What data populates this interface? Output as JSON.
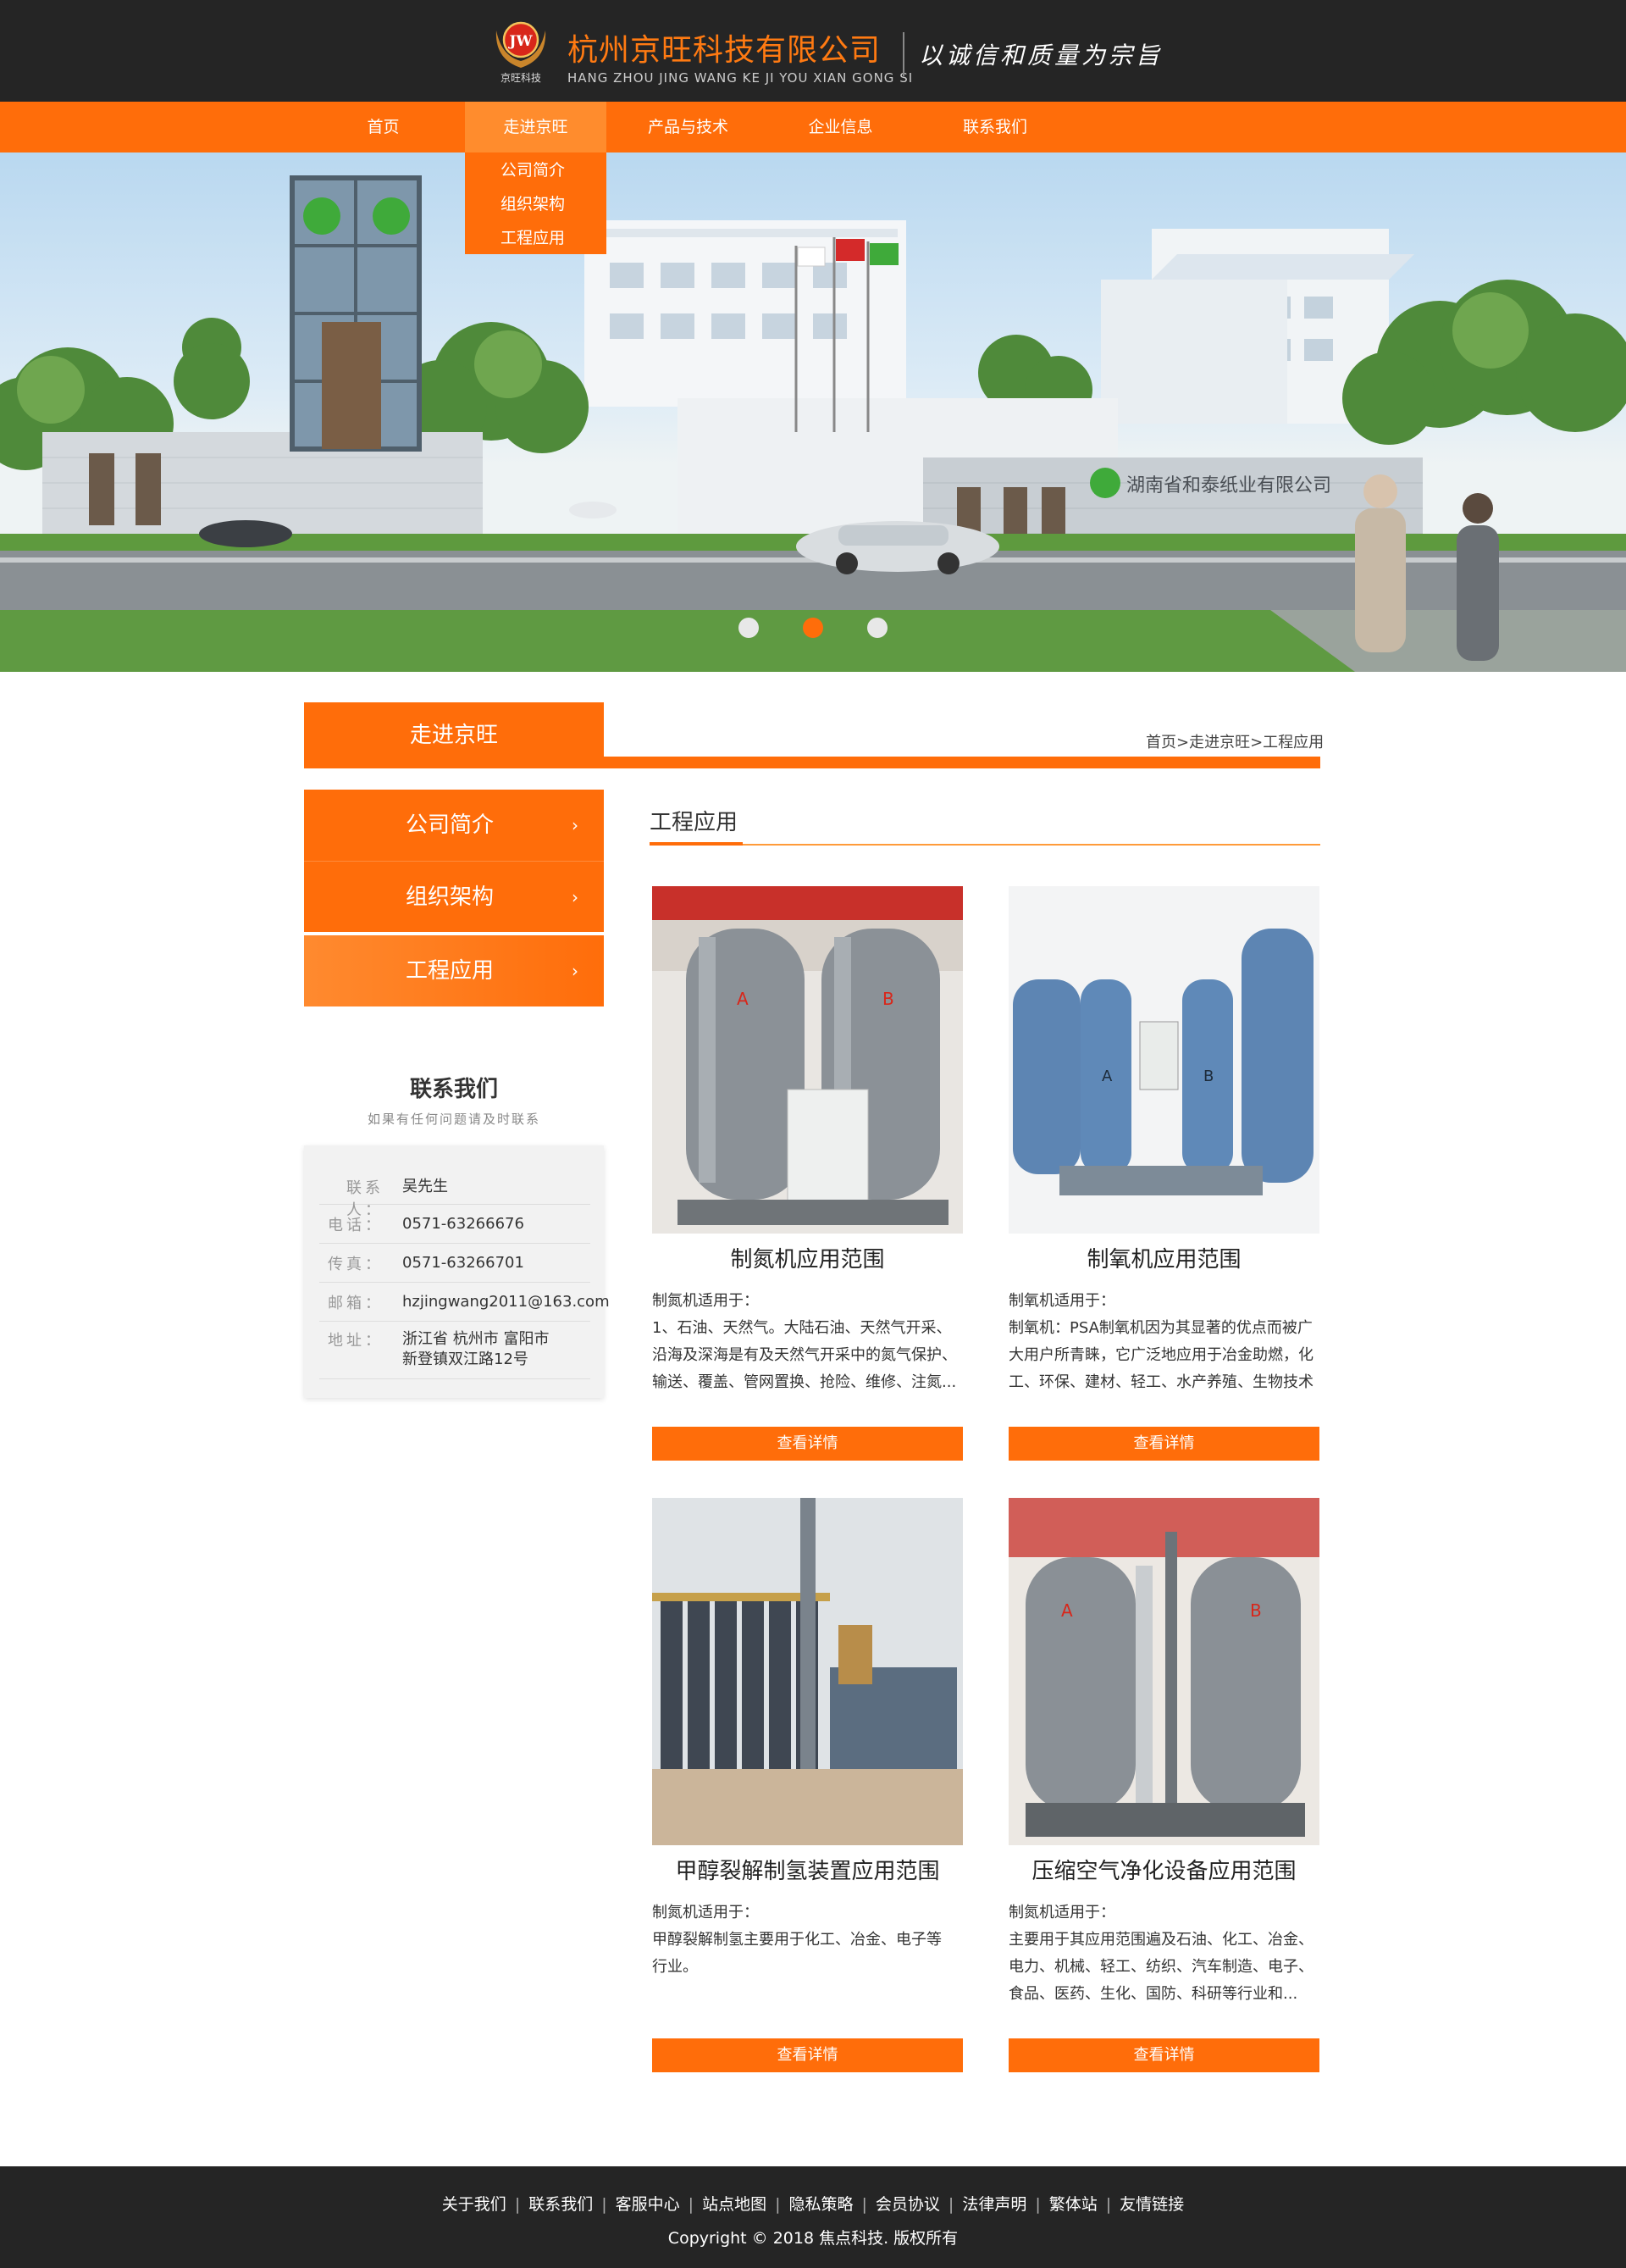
{
  "header": {
    "logo_text": "JW",
    "logo_caption": "京旺科技",
    "company_name": "杭州京旺科技有限公司",
    "company_pinyin": "HANG ZHOU JING WANG KE JI YOU XIAN GONG SI",
    "slogan": "以诚信和质量为宗旨"
  },
  "nav": {
    "items": [
      {
        "label": "首页"
      },
      {
        "label": "走进京旺"
      },
      {
        "label": "产品与技术"
      },
      {
        "label": "企业信息"
      },
      {
        "label": "联系我们"
      }
    ],
    "active_index": 1,
    "dropdown": [
      {
        "label": "公司简介"
      },
      {
        "label": "组织架构"
      },
      {
        "label": "工程应用"
      }
    ]
  },
  "banner": {
    "sign_text": "湖南省和泰纸业有限公司",
    "slides": 3,
    "active_slide": 1
  },
  "section": {
    "tab_label": "走进京旺",
    "breadcrumb": "首页>走进京旺>工程应用",
    "title": "工程应用"
  },
  "sidebar": {
    "items": [
      {
        "label": "公司简介",
        "arrow": "›"
      },
      {
        "label": "组织架构",
        "arrow": "›"
      },
      {
        "label": "工程应用",
        "arrow": "›"
      }
    ],
    "active_index": 2
  },
  "contact": {
    "title": "联系我们",
    "subtitle": "如果有任何问题请及时联系",
    "rows": [
      {
        "key": "联系人：",
        "value": "吴先生"
      },
      {
        "key": "电话：",
        "value": "0571-63266676"
      },
      {
        "key": "传真：",
        "value": "0571-63266701"
      },
      {
        "key": "邮箱：",
        "value": "hzjingwang2011@163.com"
      },
      {
        "key": "地址：",
        "value": "浙江省 杭州市 富阳市",
        "value2": "新登镇双江路12号"
      }
    ]
  },
  "cards": [
    {
      "title": "制氮机应用范围",
      "desc": [
        "制氮机适用于：",
        "1、石油、天然气。大陆石油、天然气开采、",
        "沿海及深海是有及天然气开采中的氮气保护、",
        "输送、覆盖、管网置换、抢险、维修、注氮..."
      ],
      "button": "查看详情"
    },
    {
      "title": "制氧机应用范围",
      "desc": [
        "制氧机适用于：",
        "制氧机：PSA制氧机因为其显著的优点而被广",
        "大用户所青睐，它广泛地应用于冶金助燃，化",
        "工、环保、建材、轻工、水产养殖、生物技术"
      ],
      "button": "查看详情"
    },
    {
      "title": "甲醇裂解制氢装置应用范围",
      "desc": [
        "制氮机适用于：",
        "甲醇裂解制氢主要用于化工、冶金、电子等",
        "行业。"
      ],
      "button": "查看详情"
    },
    {
      "title": "压缩空气净化设备应用范围",
      "desc": [
        "制氮机适用于：",
        "主要用于其应用范围遍及石油、化工、冶金、",
        "电力、机械、轻工、纺织、汽车制造、电子、",
        "食品、医药、生化、国防、科研等行业和..."
      ],
      "button": "查看详情"
    }
  ],
  "footer": {
    "links": [
      "关于我们",
      "联系我们",
      "客服中心",
      "站点地图",
      "隐私策略",
      "会员协议",
      "法律声明",
      "繁体站",
      "友情链接"
    ],
    "separator": "|",
    "copyright": "Copyright © 2018 焦点科技. 版权所有"
  },
  "colors": {
    "accent": "#ff6d0a",
    "dark": "#252525"
  }
}
